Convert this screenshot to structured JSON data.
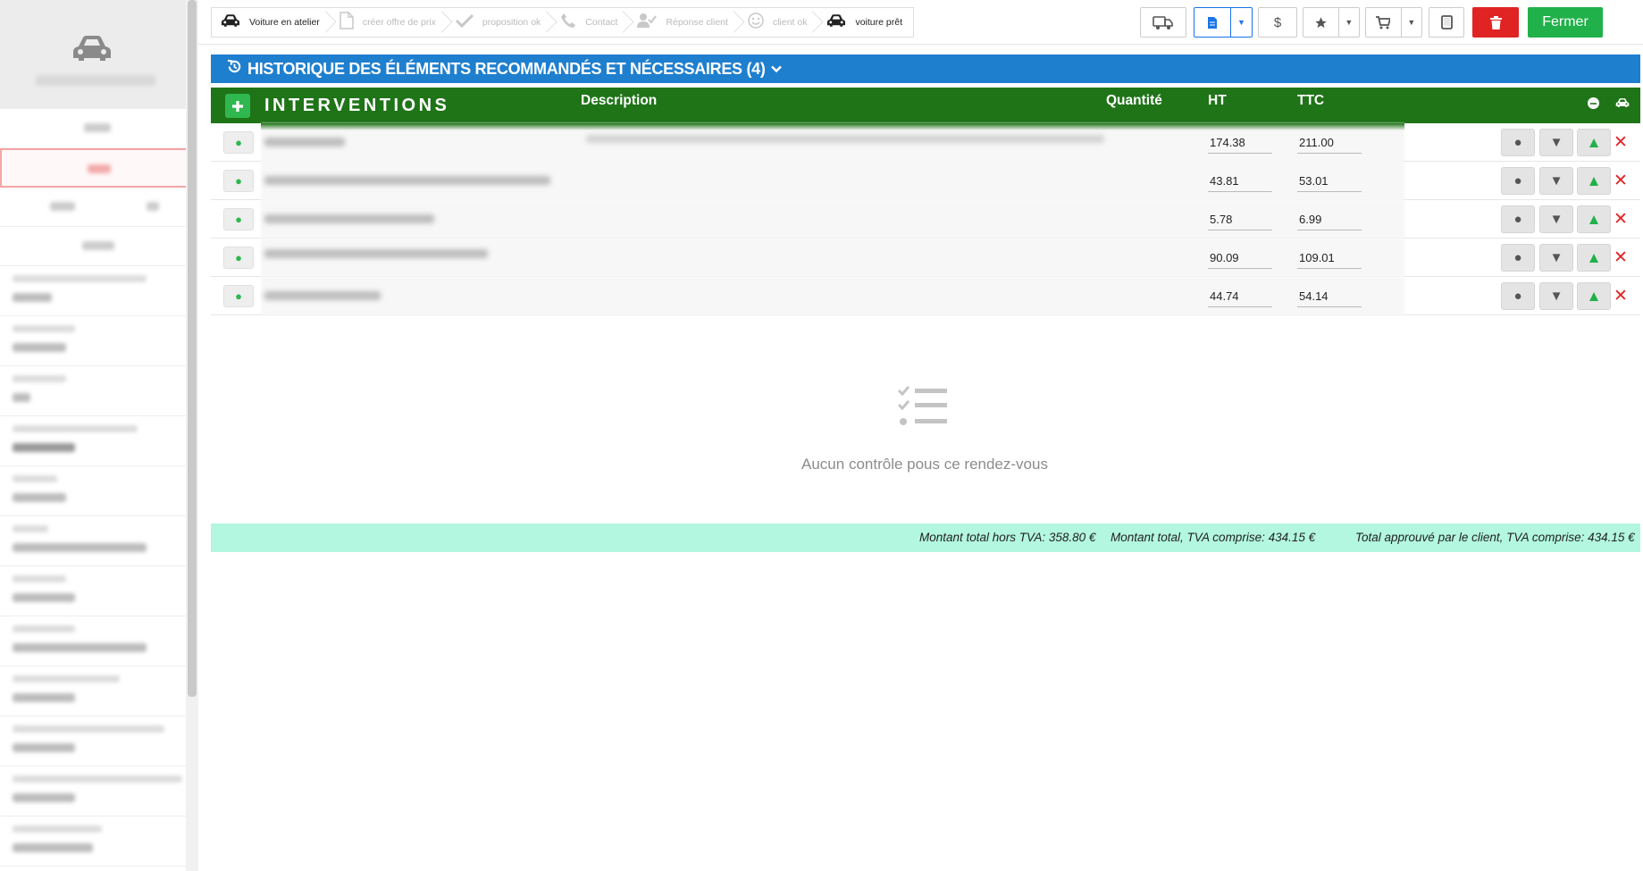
{
  "sidebar": {
    "scrollbar": true
  },
  "steps": [
    {
      "label": "Voiture en atelier",
      "icon": "car-icon",
      "state": "active"
    },
    {
      "label": "créer offre de prix",
      "icon": "file-icon",
      "state": "inactive"
    },
    {
      "label": "proposition ok",
      "icon": "check-icon",
      "state": "inactive"
    },
    {
      "label": "Contact",
      "icon": "phone-icon",
      "state": "inactive"
    },
    {
      "label": "Réponse client",
      "icon": "user-check-icon",
      "state": "inactive"
    },
    {
      "label": "client ok",
      "icon": "smile-icon",
      "state": "inactive"
    },
    {
      "label": "voiture prêt",
      "icon": "car-icon",
      "state": "active"
    }
  ],
  "toolbar": {
    "dollar_symbol": "$",
    "close_label": "Fermer"
  },
  "history": {
    "title": "HISTORIQUE DES ÉLÉMENTS RECOMMANDÉS ET NÉCESSAIRES (4)"
  },
  "interventions": {
    "title": "INTERVENTIONS",
    "columns": {
      "description": "Description",
      "quantity": "Quantité",
      "ht": "HT",
      "ttc": "TTC"
    },
    "rows": [
      {
        "ht": "174.38",
        "ttc": "211.00"
      },
      {
        "ht": "43.81",
        "ttc": "53.01"
      },
      {
        "ht": "5.78",
        "ttc": "6.99"
      },
      {
        "ht": "90.09",
        "ttc": "109.01"
      },
      {
        "ht": "44.74",
        "ttc": "54.14"
      }
    ]
  },
  "empty_state": {
    "text": "Aucun contrôle pous ce rendez-vous"
  },
  "totals": {
    "ht": "Montant total hors TVA: 358.80 €",
    "ttc": "Montant total, TVA comprise: 434.15 €",
    "approved": "Total approuvé par le client, TVA comprise: 434.15 €"
  },
  "colors": {
    "history_bar": "#1f7fcf",
    "interventions_header": "#1f7418",
    "totals_bg": "#b3f7e0",
    "close_button": "#21b14a",
    "delete_button": "#e02424"
  }
}
